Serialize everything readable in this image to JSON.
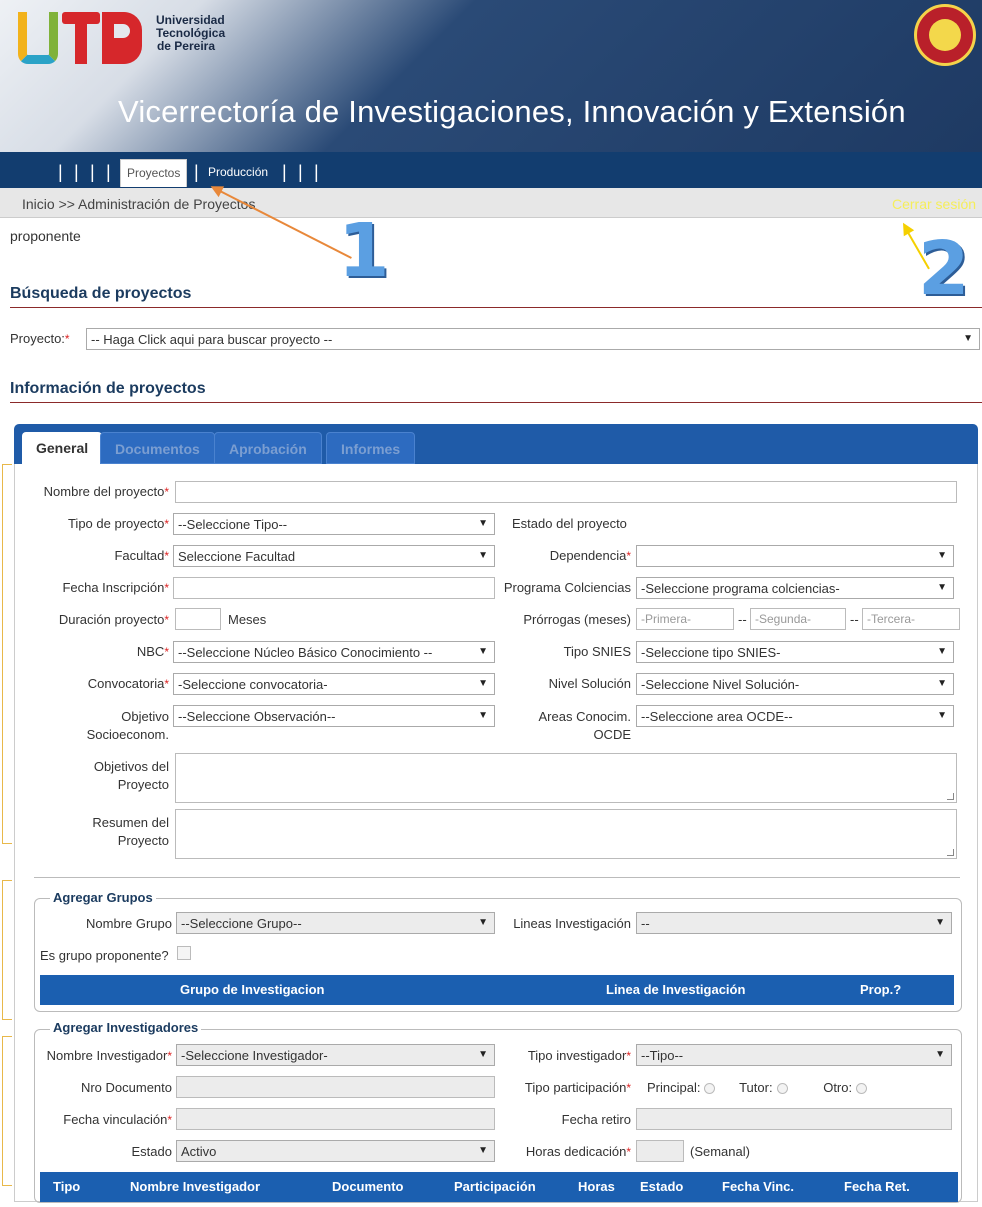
{
  "header": {
    "university": [
      "Universidad",
      "Tecnológica",
      "de Pereira"
    ],
    "title": "Vicerrectoría de Investigaciones, Innovación y Extensión",
    "seal_icon": "colombia-seal-icon"
  },
  "nav": {
    "tab_proyectos": "Proyectos",
    "link_produccion": "Producción",
    "separator": "|"
  },
  "breadcrumb": {
    "text": "Inicio >> Administración de Proyectos",
    "logout": "Cerrar sesión"
  },
  "user_role": "proponente",
  "search": {
    "heading": "Búsqueda de proyectos",
    "label": "Proyecto:",
    "required": "*",
    "value": "-- Haga Click aqui para buscar proyecto --"
  },
  "info": {
    "heading": "Información de proyectos"
  },
  "tabs": [
    "General",
    "Documentos",
    "Aprobación",
    "Informes"
  ],
  "general": {
    "nombre_label": "Nombre del proyecto",
    "nombre_value": "",
    "tipo_label": "Tipo de proyecto",
    "tipo_value": "--Seleccione Tipo--",
    "estado_label": "Estado del proyecto",
    "facultad_label": "Facultad",
    "facultad_value": "Seleccione Facultad",
    "dependencia_label": "Dependencia",
    "dependencia_value": "",
    "fecha_label": "Fecha Inscripción",
    "programa_label": "Programa Colciencias",
    "programa_value": "-Seleccione programa colciencias-",
    "duracion_label": "Duración proyecto",
    "duracion_unit": "Meses",
    "prorrogas_label": "Prórrogas (meses)",
    "prorroga_1": "-Primera-",
    "prorroga_2": "-Segunda-",
    "prorroga_3": "-Tercera-",
    "prorroga_sep": "--",
    "nbc_label": "NBC",
    "nbc_value": "--Seleccione Núcleo Básico Conocimiento --",
    "snies_label": "Tipo SNIES",
    "snies_value": "-Seleccione tipo SNIES-",
    "convocatoria_label": "Convocatoria",
    "convocatoria_value": "-Seleccione convocatoria-",
    "nivel_label": "Nivel Solución",
    "nivel_value": "-Seleccione Nivel Solución-",
    "objetivo_label_1": "Objetivo",
    "objetivo_label_2": "Socioeconom.",
    "objetivo_value": "--Seleccione Observación--",
    "areas_label_1": "Areas Conocim.",
    "areas_label_2": "OCDE",
    "areas_value": "--Seleccione area OCDE--",
    "objetivos_label_1": "Objetivos del",
    "objetivos_label_2": "Proyecto",
    "resumen_label_1": "Resumen del",
    "resumen_label_2": "Proyecto",
    "required": "*"
  },
  "grupos": {
    "legend": "Agregar Grupos",
    "nombre_label": "Nombre Grupo",
    "nombre_value": "--Seleccione Grupo--",
    "lineas_label": "Lineas Investigación",
    "lineas_value": "--",
    "proponente_label": "Es grupo proponente?",
    "columns": [
      "Grupo de Investigacion",
      "Linea de Investigación",
      "Prop.?"
    ]
  },
  "investigadores": {
    "legend": "Agregar Investigadores",
    "nombre_label": "Nombre Investigador",
    "nombre_value": "-Seleccione Investigador-",
    "tipo_label": "Tipo investigador",
    "tipo_value": "--Tipo--",
    "doc_label": "Nro Documento",
    "participacion_label": "Tipo participación",
    "opt_principal": "Principal:",
    "opt_tutor": "Tutor:",
    "opt_otro": "Otro:",
    "vinculacion_label": "Fecha vinculación",
    "retiro_label": "Fecha retiro",
    "estado_label": "Estado",
    "estado_value": "Activo",
    "horas_label": "Horas dedicación",
    "horas_unit": "(Semanal)",
    "columns": [
      "Tipo",
      "Nombre Investigador",
      "Documento",
      "Participación",
      "Horas",
      "Estado",
      "Fecha Vinc.",
      "Fecha Ret."
    ]
  },
  "annotations": {
    "one": "1",
    "two": "2",
    "arrow_color_1": "#e8883a",
    "arrow_color_2": "#f5d000"
  }
}
